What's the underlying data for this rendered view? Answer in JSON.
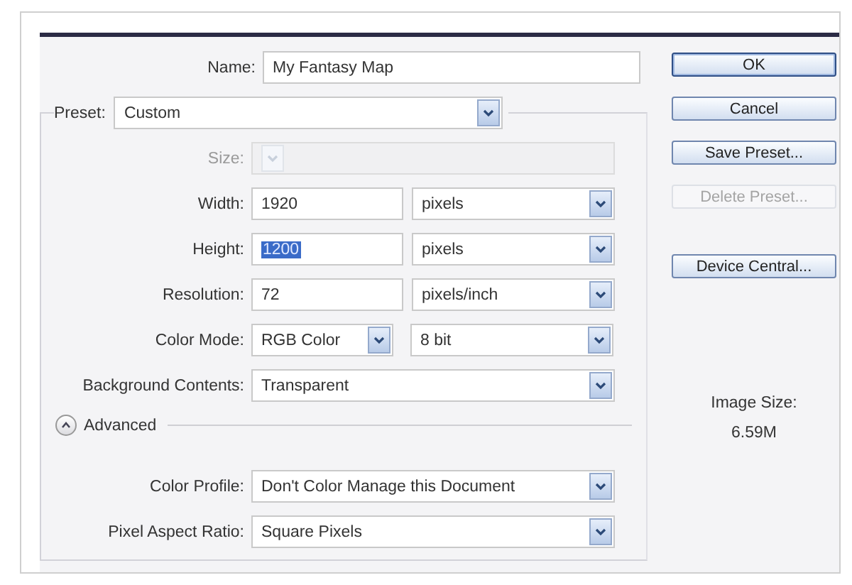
{
  "name_field": {
    "label": "Name:",
    "value": "My Fantasy Map"
  },
  "preset": {
    "label": "Preset:",
    "value": "Custom"
  },
  "rows": [
    {
      "kind": "select",
      "label": "Size:",
      "disabled": true
    },
    {
      "kind": "number",
      "label": "Width:",
      "value": "1920",
      "highlighted": false,
      "unit": "pixels"
    },
    {
      "kind": "number",
      "label": "Height:",
      "value": "1200",
      "highlighted": true,
      "unit": "pixels"
    },
    {
      "kind": "number",
      "label": "Resolution:",
      "value": "72",
      "highlighted": false,
      "unit": "pixels/inch"
    },
    {
      "kind": "pair",
      "label": "Color Mode:",
      "value": "RGB Color",
      "value2": "8 bit"
    },
    {
      "kind": "select",
      "label": "Background Contents:",
      "value": "Transparent",
      "disabled": false
    }
  ],
  "advanced": {
    "label": "Advanced",
    "expanded": true,
    "rows": [
      {
        "kind": "select",
        "label": "Color Profile:",
        "value": "Don't Color Manage this Document",
        "disabled": false
      },
      {
        "kind": "select",
        "label": "Pixel Aspect Ratio:",
        "value": "Square Pixels",
        "disabled": false
      }
    ]
  },
  "buttons": [
    {
      "label": "OK",
      "disabled": false,
      "default": true
    },
    {
      "label": "Cancel",
      "disabled": false,
      "default": false
    },
    {
      "label": "Save Preset...",
      "disabled": false,
      "default": false
    },
    {
      "label": "Delete Preset...",
      "disabled": true,
      "default": false
    }
  ],
  "extra_buttons": [
    {
      "label": "Device Central...",
      "disabled": false,
      "default": false
    }
  ],
  "image_size": {
    "label": "Image Size:",
    "value": "6.59M"
  }
}
